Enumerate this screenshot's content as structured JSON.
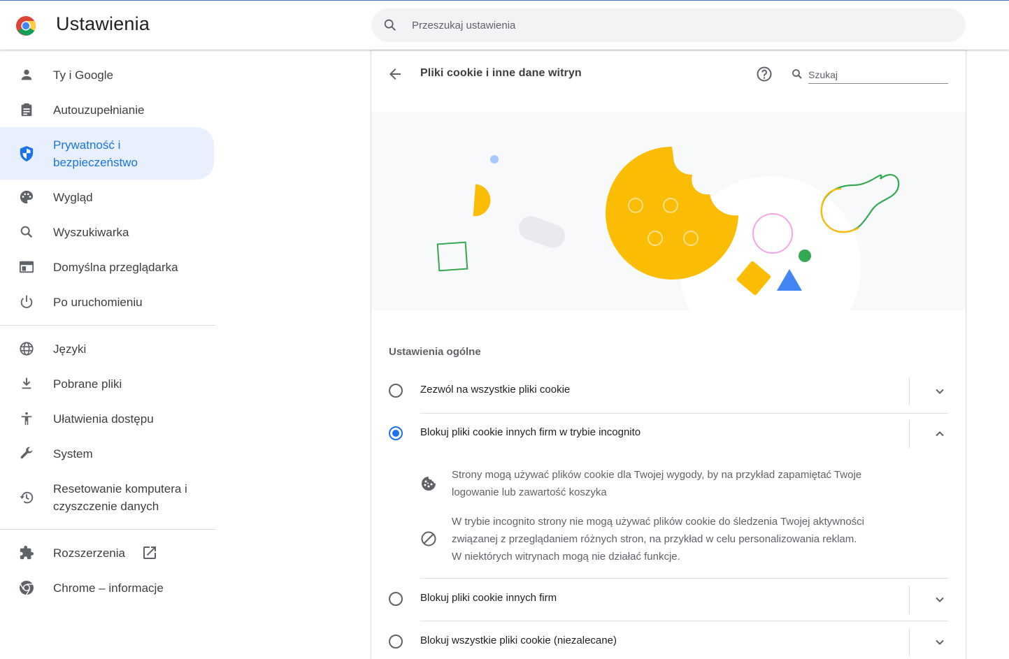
{
  "app": {
    "title": "Ustawienia"
  },
  "search": {
    "placeholder": "Przeszukaj ustawienia"
  },
  "sidebar": {
    "items": [
      {
        "label": "Ty i Google",
        "icon": "person-icon"
      },
      {
        "label": "Autouzupełnianie",
        "icon": "clipboard-icon"
      },
      {
        "label": "Prywatność i bezpieczeństwo",
        "icon": "shield-icon",
        "active": true
      },
      {
        "label": "Wygląd",
        "icon": "palette-icon"
      },
      {
        "label": "Wyszukiwarka",
        "icon": "search-icon"
      },
      {
        "label": "Domyślna przeglądarka",
        "icon": "browser-window-icon"
      },
      {
        "label": "Po uruchomieniu",
        "icon": "power-icon"
      },
      {
        "label": "Języki",
        "icon": "globe-icon"
      },
      {
        "label": "Pobrane pliki",
        "icon": "download-icon"
      },
      {
        "label": "Ułatwienia dostępu",
        "icon": "accessibility-icon"
      },
      {
        "label": "System",
        "icon": "wrench-icon"
      },
      {
        "label": "Resetowanie komputera i czyszczenie danych",
        "icon": "restore-icon"
      },
      {
        "label": "Rozszerzenia",
        "icon": "puzzle-icon"
      },
      {
        "label": "Chrome – informacje",
        "icon": "chrome-icon"
      }
    ]
  },
  "page": {
    "title": "Pliki cookie i inne dane witryn",
    "search_placeholder": "Szukaj",
    "section_title": "Ustawienia ogólne",
    "options": [
      {
        "label": "Zezwól na wszystkie pliki cookie",
        "checked": false,
        "expanded": false
      },
      {
        "label": "Blokuj pliki cookie innych firm w trybie incognito",
        "checked": true,
        "expanded": true
      },
      {
        "label": "Blokuj pliki cookie innych firm",
        "checked": false,
        "expanded": false
      },
      {
        "label": "Blokuj wszystkie pliki cookie (niezalecane)",
        "checked": false,
        "expanded": false
      }
    ],
    "details": [
      {
        "icon": "cookie-icon",
        "line1": "Strony mogą używać plików cookie dla Twojej wygody, by na przykład zapamiętać Twoje",
        "line2": "logowanie lub zawartość koszyka"
      },
      {
        "icon": "block-icon",
        "line1": "W trybie incognito strony nie mogą używać plików cookie do śledzenia Twojej aktywności",
        "line2": "związanej z przeglądaniem różnych stron, na przykład w celu personalizowania reklam.",
        "line3": "W niektórych witrynach mogą nie działać funkcje."
      }
    ]
  },
  "colors": {
    "accent": "#1a73e8",
    "active_bg": "#e8f0fe",
    "cookie": "#fbbc04"
  }
}
